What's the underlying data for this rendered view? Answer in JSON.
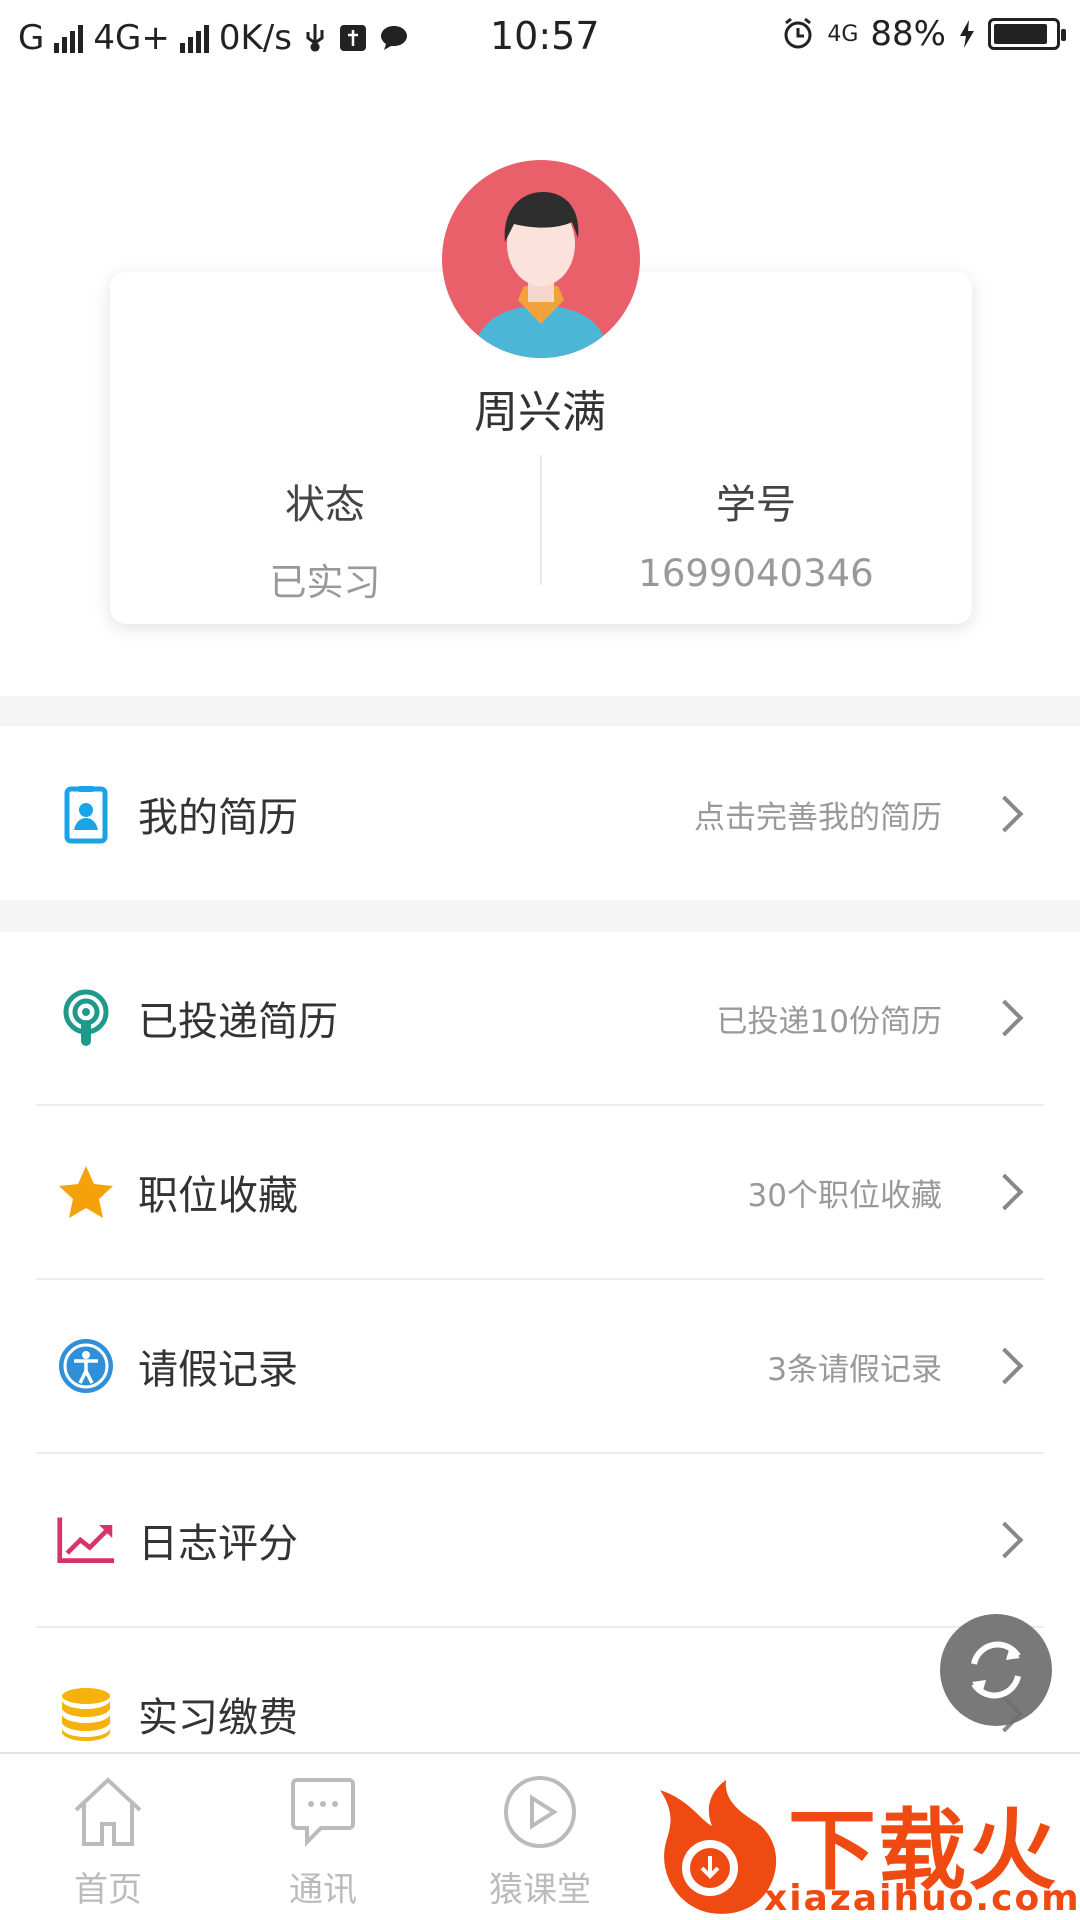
{
  "status_bar": {
    "carrier_left": "G",
    "network": "4G+",
    "speed": "0K/s",
    "time": "10:57",
    "network_right": "4G",
    "battery_percent": "88%",
    "battery_level": 0.88,
    "icons": [
      "signal-icon",
      "usb-icon",
      "usb-debug-icon",
      "chat-icon",
      "alarm-icon",
      "charging-icon",
      "battery-icon"
    ]
  },
  "profile": {
    "name": "周兴满",
    "status_label": "状态",
    "status_value": "已实习",
    "id_label": "学号",
    "id_value": "1699040346"
  },
  "menu": [
    {
      "title": "我的简历",
      "hint": "点击完善我的简历",
      "icon": "resume-card-icon",
      "color": "#1aa3e8"
    },
    {
      "title": "已投递简历",
      "hint": "已投递10份简历",
      "icon": "podcast-icon",
      "color": "#1f9a8a"
    },
    {
      "title": "职位收藏",
      "hint": "30个职位收藏",
      "icon": "star-icon",
      "color": "#f5a20a"
    },
    {
      "title": "请假记录",
      "hint": "3条请假记录",
      "icon": "accessibility-icon",
      "color": "#2f8fd8"
    },
    {
      "title": "日志评分",
      "hint": "",
      "icon": "trend-chart-icon",
      "color": "#d8336b"
    },
    {
      "title": "实习缴费",
      "hint": "",
      "icon": "coins-icon",
      "color": "#f5b20a"
    }
  ],
  "bottom_nav": [
    {
      "label": "首页",
      "icon": "home-icon"
    },
    {
      "label": "通讯",
      "icon": "message-icon"
    },
    {
      "label": "猿课堂",
      "icon": "play-icon"
    }
  ],
  "watermark": {
    "text": "下载火",
    "url": "xiazaihuo.com"
  },
  "colors": {
    "accent_orange": "#ee4a12",
    "avatar_bg": "#e9606a",
    "separator": "#f5f5f5"
  }
}
